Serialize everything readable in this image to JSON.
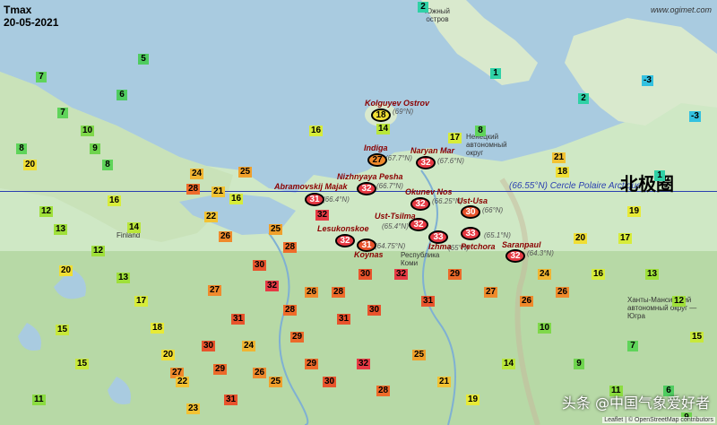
{
  "header": {
    "title": "Tmax",
    "date": "20-05-2021",
    "site": "www.ogimet.com"
  },
  "arctic_circle": {
    "label": "Cercle Polaire Arctique",
    "lat": "(66.55°N)",
    "chinese_label": "北极圈"
  },
  "colors": {
    "sea": "#a9cbe0",
    "land": "#d9e9cd",
    "forest": "#b7d9a6",
    "circle_line": "#2a3fb0"
  },
  "highlights": [
    {
      "city": "Kolguyev Ostrov",
      "lat": "(69°N)",
      "value": "18"
    },
    {
      "city": "Indiga",
      "lat": "(67.7°N)",
      "value": "27"
    },
    {
      "city": "Naryan Mar",
      "lat": "(67.6°N)",
      "value": "32"
    },
    {
      "city": "Nizhnyaya Pesha",
      "lat": "(66.7°N)",
      "value": "32"
    },
    {
      "city": "Abramovskij Majak",
      "lat": "(66.4°N)",
      "value": "31"
    },
    {
      "city": "Okunev Nos",
      "lat": "(66.25°N)",
      "value": "32"
    },
    {
      "city": "Ust-Usa",
      "lat": "(66°N)",
      "value": "30"
    },
    {
      "city": "Ust-Tsilma",
      "lat": "(65.4°N)",
      "value": "32"
    },
    {
      "city": "Lesukonskoe",
      "lat": "",
      "value": "32"
    },
    {
      "city": "Koynas",
      "lat": "(64.75°N)",
      "value": "31"
    },
    {
      "city": "Izhma",
      "lat": "(65°N)",
      "value": "33"
    },
    {
      "city": "Petchora",
      "lat": "(65.1°N)",
      "value": "33"
    },
    {
      "city": "Saranpaul",
      "lat": "(64.3°N)",
      "value": "32"
    }
  ],
  "places": {
    "island": "Южный остров",
    "nao": "Ненецкий автономный округ",
    "komi": "Республика Коми",
    "finland": "Finland",
    "khanty": "Ханты-Мансийский автономный округ — Югра"
  },
  "attribution": "Leaflet | © OpenStreetMap contributors",
  "watermark": "头条 @中国气象爱好者",
  "markers": [
    {
      "v": "2",
      "c": "#2fd1a6"
    },
    {
      "v": "1",
      "c": "#2fd1a6"
    },
    {
      "v": "-3",
      "c": "#33c1e0"
    },
    {
      "v": "-3",
      "c": "#33c1e0"
    },
    {
      "v": "2",
      "c": "#2fd1a6"
    },
    {
      "v": "1",
      "c": "#2fd1a6"
    },
    {
      "v": "8",
      "c": "#5fd45a"
    },
    {
      "v": "17",
      "c": "#d7ec3a"
    },
    {
      "v": "16",
      "c": "#d7ec3a"
    },
    {
      "v": "14",
      "c": "#b9e63a"
    },
    {
      "v": "21",
      "c": "#f2c233"
    },
    {
      "v": "18",
      "c": "#f0de34"
    },
    {
      "v": "25",
      "c": "#f0a02c"
    },
    {
      "v": "28",
      "c": "#ef6b2a"
    },
    {
      "v": "24",
      "c": "#f0b432"
    },
    {
      "v": "21",
      "c": "#f2c233"
    },
    {
      "v": "16",
      "c": "#d7ec3a"
    },
    {
      "v": "14",
      "c": "#b9e63a"
    },
    {
      "v": "7",
      "c": "#5fd45a"
    },
    {
      "v": "22",
      "c": "#f2c233"
    },
    {
      "v": "26",
      "c": "#ef8a2c"
    },
    {
      "v": "32",
      "c": "#e63a44"
    },
    {
      "v": "28",
      "c": "#ef6b2a"
    },
    {
      "v": "30",
      "c": "#e8532c"
    },
    {
      "v": "31",
      "c": "#e8532c"
    },
    {
      "v": "25",
      "c": "#f0a02c"
    },
    {
      "v": "27",
      "c": "#ef8a2c"
    },
    {
      "v": "29",
      "c": "#ec6a2a"
    },
    {
      "v": "32",
      "c": "#e63a44"
    },
    {
      "v": "30",
      "c": "#e8532c"
    },
    {
      "v": "30",
      "c": "#e8532c"
    },
    {
      "v": "26",
      "c": "#ef8a2c"
    },
    {
      "v": "20",
      "c": "#f0de34"
    },
    {
      "v": "16",
      "c": "#d7ec3a"
    },
    {
      "v": "12",
      "c": "#9fe03a"
    },
    {
      "v": "13",
      "c": "#9fe03a"
    },
    {
      "v": "10",
      "c": "#7fd84a"
    },
    {
      "v": "9",
      "c": "#6fd44e"
    },
    {
      "v": "8",
      "c": "#5fd45a"
    },
    {
      "v": "6",
      "c": "#4fcc60"
    },
    {
      "v": "5",
      "c": "#4fcc60"
    },
    {
      "v": "20",
      "c": "#f0de34"
    },
    {
      "v": "29",
      "c": "#ec6a2a"
    },
    {
      "v": "31",
      "c": "#e8532c"
    },
    {
      "v": "27",
      "c": "#ef8a2c"
    },
    {
      "v": "7",
      "c": "#5fd45a"
    },
    {
      "v": "6",
      "c": "#4fcc60"
    },
    {
      "v": "9",
      "c": "#6fd44e"
    },
    {
      "v": "15",
      "c": "#c8e83a"
    },
    {
      "v": "15",
      "c": "#c8e83a"
    },
    {
      "v": "11",
      "c": "#8bdc40"
    },
    {
      "v": "8",
      "c": "#5fd45a"
    },
    {
      "v": "7",
      "c": "#5fd45a"
    },
    {
      "v": "12",
      "c": "#9fe03a"
    },
    {
      "v": "13",
      "c": "#9fe03a"
    },
    {
      "v": "17",
      "c": "#d7ec3a"
    },
    {
      "v": "18",
      "c": "#e8ea36"
    },
    {
      "v": "20",
      "c": "#f0de34"
    },
    {
      "v": "22",
      "c": "#f2c233"
    },
    {
      "v": "23",
      "c": "#f2c233"
    },
    {
      "v": "24",
      "c": "#f0b432"
    },
    {
      "v": "26",
      "c": "#ef8a2c"
    },
    {
      "v": "28",
      "c": "#ef6b2a"
    },
    {
      "v": "29",
      "c": "#ec6a2a"
    },
    {
      "v": "30",
      "c": "#e8532c"
    },
    {
      "v": "31",
      "c": "#e8532c"
    },
    {
      "v": "32",
      "c": "#e63a44"
    },
    {
      "v": "28",
      "c": "#ef6b2a"
    },
    {
      "v": "25",
      "c": "#f0a02c"
    },
    {
      "v": "21",
      "c": "#f2c233"
    },
    {
      "v": "19",
      "c": "#e8ea36"
    },
    {
      "v": "14",
      "c": "#b9e63a"
    },
    {
      "v": "10",
      "c": "#7fd84a"
    },
    {
      "v": "9",
      "c": "#6fd44e"
    },
    {
      "v": "11",
      "c": "#8bdc40"
    },
    {
      "v": "13",
      "c": "#9fe03a"
    },
    {
      "v": "12",
      "c": "#9fe03a"
    },
    {
      "v": "15",
      "c": "#c8e83a"
    },
    {
      "v": "16",
      "c": "#d7ec3a"
    },
    {
      "v": "17",
      "c": "#d7ec3a"
    },
    {
      "v": "19",
      "c": "#e8ea36"
    },
    {
      "v": "20",
      "c": "#f0de34"
    },
    {
      "v": "24",
      "c": "#f0b432"
    },
    {
      "v": "26",
      "c": "#ef8a2c"
    },
    {
      "v": "27",
      "c": "#ef8a2c"
    },
    {
      "v": "29",
      "c": "#ec6a2a"
    },
    {
      "v": "31",
      "c": "#e8532c"
    },
    {
      "v": "32",
      "c": "#e63a44"
    },
    {
      "v": "30",
      "c": "#e8532c"
    },
    {
      "v": "28",
      "c": "#ef6b2a"
    },
    {
      "v": "26",
      "c": "#ef8a2c"
    },
    {
      "v": "25",
      "c": "#f0a02c"
    }
  ]
}
